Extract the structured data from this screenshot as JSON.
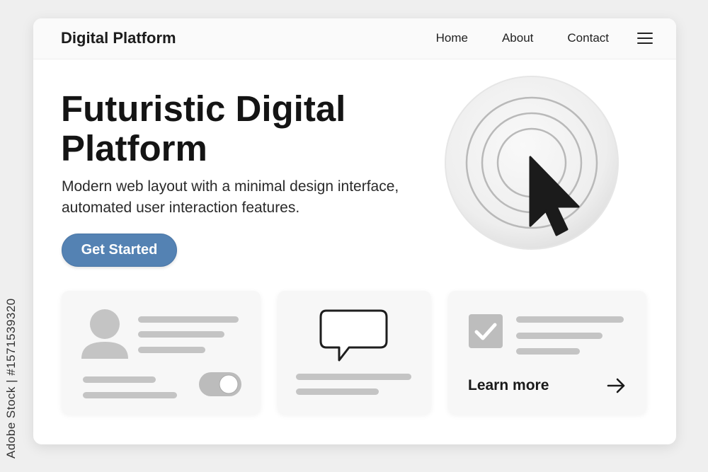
{
  "watermark": {
    "side_text": "Adobe Stock | #1571539320"
  },
  "navbar": {
    "brand": "Digital Platform",
    "links": [
      {
        "label": "Home"
      },
      {
        "label": "About"
      },
      {
        "label": "Contact"
      }
    ],
    "menu_icon": "hamburger-menu-icon"
  },
  "hero": {
    "title": "Futuristic Digital Platform",
    "subtitle": "Modern web layout with a minimal design interface, automated user interaction features.",
    "cta_label": "Get Started",
    "illustration_icon": "cursor-click-ripple-icon"
  },
  "cards": [
    {
      "icon": "user-avatar-icon",
      "toggle_on": true
    },
    {
      "icon": "chat-bubble-icon"
    },
    {
      "icon": "checkbox-checked-icon",
      "link_label": "Learn more",
      "link_icon": "arrow-right-icon"
    }
  ],
  "colors": {
    "accent": "#5482b3",
    "background": "#efefef",
    "placeholder": "#c4c4c4"
  }
}
